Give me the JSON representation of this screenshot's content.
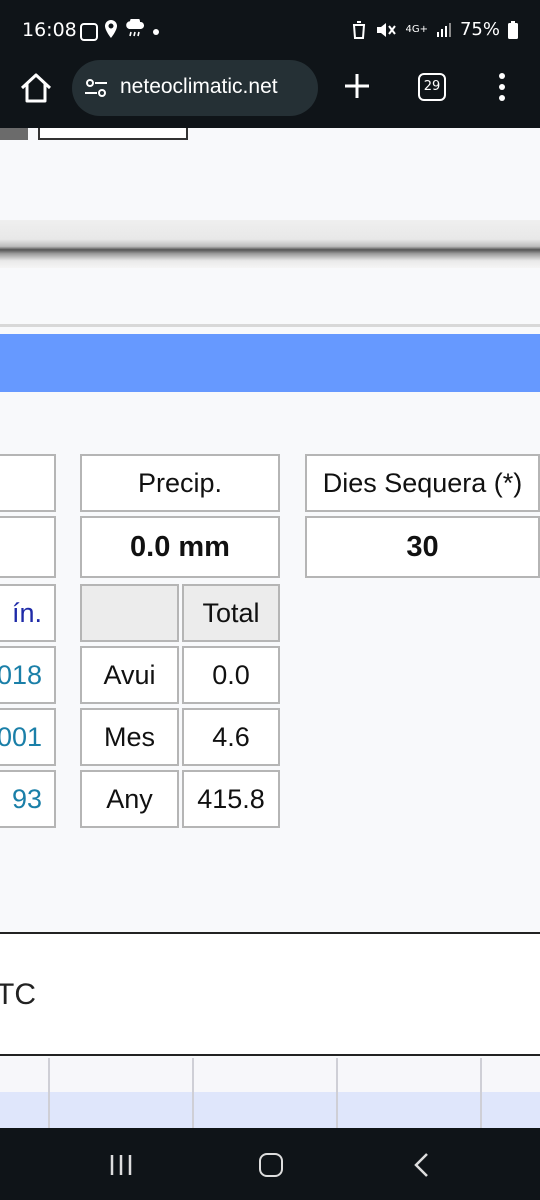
{
  "status_bar": {
    "time": "16:08",
    "battery": "75%",
    "network": "4G+"
  },
  "browser": {
    "url": "neteoclimatic.net",
    "tab_count": "29"
  },
  "precip_table": {
    "header": "Precip.",
    "value": "0.0 mm",
    "total_label": "Total",
    "rows": [
      {
        "label": "Avui",
        "value": "0.0"
      },
      {
        "label": "Mes",
        "value": "4.6"
      },
      {
        "label": "Any",
        "value": "415.8"
      }
    ]
  },
  "drought_table": {
    "header": "Dies Sequera (*)",
    "value": "30"
  },
  "left_partial_table": {
    "label": "ín.",
    "values": [
      "018",
      "001",
      "93"
    ]
  },
  "footer_partial_text": "TC",
  "colors": {
    "bars": "#0f1418",
    "band": "#6699ff",
    "link": "#1a7fa8"
  }
}
